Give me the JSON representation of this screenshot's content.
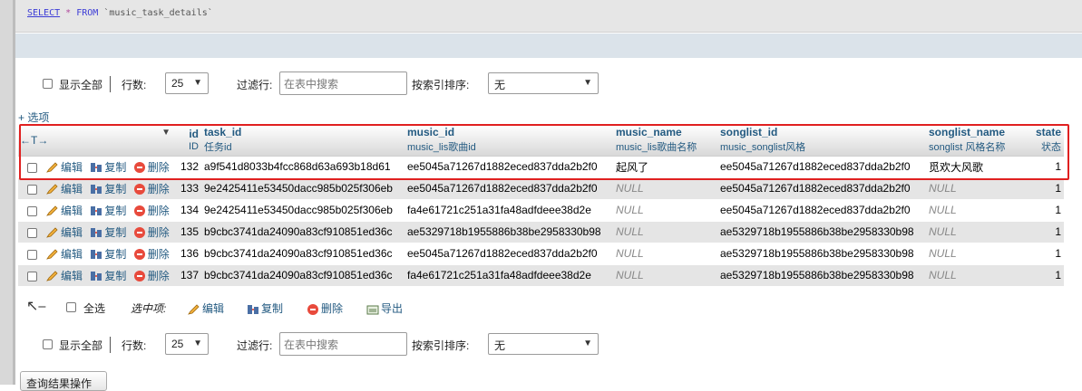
{
  "sql": {
    "select_kw": "SELECT",
    "star": "*",
    "from_kw": "FROM",
    "table": "`music_task_details`"
  },
  "nav_top": {
    "show_all_label": "显示全部",
    "rows_label": "行数:",
    "rows_value": "25",
    "filter_label": "过滤行:",
    "filter_placeholder": "在表中搜索",
    "sort_label": "按索引排序:",
    "sort_value": "无"
  },
  "nav_bottom": {
    "show_all_label": "显示全部",
    "rows_label": "行数:",
    "rows_value": "25",
    "filter_label": "过滤行:",
    "filter_placeholder": "在表中搜索",
    "sort_label": "按索引排序:",
    "sort_value": "无"
  },
  "options_link": "+ 选项",
  "columns": [
    {
      "name": "id",
      "comment": "ID"
    },
    {
      "name": "task_id",
      "comment": "任务id"
    },
    {
      "name": "music_id",
      "comment": "music_lis歌曲id"
    },
    {
      "name": "music_name",
      "comment": "music_lis歌曲名称"
    },
    {
      "name": "songlist_id",
      "comment": "music_songlist风格"
    },
    {
      "name": "songlist_name",
      "comment": "songlist 风格名称"
    },
    {
      "name": "state",
      "comment": "状态"
    }
  ],
  "row_actions": {
    "edit": "编辑",
    "copy": "复制",
    "delete": "删除"
  },
  "rows": [
    {
      "id": "132",
      "task_id": "a9f541d8033b4fcc868d63a693b18d61",
      "music_id": "ee5045a71267d1882eced837dda2b2f0",
      "music_name": "起风了",
      "songlist_id": "ee5045a71267d1882eced837dda2b2f0",
      "songlist_name": "觅欢大风歌",
      "state": "1"
    },
    {
      "id": "133",
      "task_id": "9e2425411e53450dacc985b025f306eb",
      "music_id": "ee5045a71267d1882eced837dda2b2f0",
      "music_name": "NULL",
      "songlist_id": "ee5045a71267d1882eced837dda2b2f0",
      "songlist_name": "NULL",
      "state": "1"
    },
    {
      "id": "134",
      "task_id": "9e2425411e53450dacc985b025f306eb",
      "music_id": "fa4e61721c251a31fa48adfdeee38d2e",
      "music_name": "NULL",
      "songlist_id": "ee5045a71267d1882eced837dda2b2f0",
      "songlist_name": "NULL",
      "state": "1"
    },
    {
      "id": "135",
      "task_id": "b9cbc3741da24090a83cf910851ed36c",
      "music_id": "ae5329718b1955886b38be2958330b98",
      "music_name": "NULL",
      "songlist_id": "ae5329718b1955886b38be2958330b98",
      "songlist_name": "NULL",
      "state": "1"
    },
    {
      "id": "136",
      "task_id": "b9cbc3741da24090a83cf910851ed36c",
      "music_id": "ee5045a71267d1882eced837dda2b2f0",
      "music_name": "NULL",
      "songlist_id": "ae5329718b1955886b38be2958330b98",
      "songlist_name": "NULL",
      "state": "1"
    },
    {
      "id": "137",
      "task_id": "b9cbc3741da24090a83cf910851ed36c",
      "music_id": "fa4e61721c251a31fa48adfdeee38d2e",
      "music_name": "NULL",
      "songlist_id": "ae5329718b1955886b38be2958330b98",
      "songlist_name": "NULL",
      "state": "1"
    }
  ],
  "bulk": {
    "select_all": "全选",
    "with_selected": "选中项:",
    "edit": "编辑",
    "copy": "复制",
    "delete": "删除",
    "export": "导出"
  },
  "query_ops_button": "查询结果操作",
  "colors": {
    "link": "#235a81",
    "highlight": "#e02020",
    "delete_icon": "#e84a3c"
  }
}
